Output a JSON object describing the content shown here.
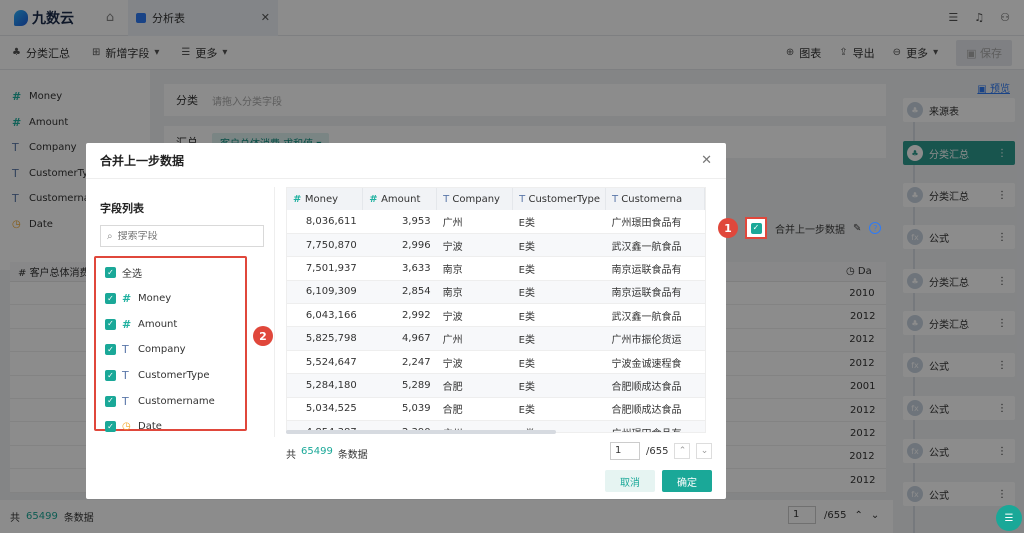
{
  "app": {
    "name": "九数云",
    "tab_title": "分析表"
  },
  "toolbar": {
    "items": [
      "分类汇总",
      "新增字段",
      "更多"
    ],
    "right": [
      "图表",
      "导出",
      "更多",
      "保存"
    ]
  },
  "fields": [
    {
      "type": "num",
      "name": "Money"
    },
    {
      "type": "num",
      "name": "Amount"
    },
    {
      "type": "text",
      "name": "Company"
    },
    {
      "type": "text",
      "name": "CustomerTy"
    },
    {
      "type": "text",
      "name": "Customerna"
    },
    {
      "type": "date",
      "name": "Date"
    }
  ],
  "config": {
    "group_label": "分类",
    "group_placeholder": "请拖入分类字段",
    "summary_label": "汇总",
    "summary_pill": "客户总体消费",
    "summary_pill_sub": "求和值"
  },
  "bg_table": {
    "head_left": "客户总体消费",
    "head_right": "Da",
    "rows": [
      {
        "a": "",
        "b": "2010"
      },
      {
        "a": "司",
        "b": "2012"
      },
      {
        "a": "",
        "b": "2012"
      },
      {
        "a": "",
        "b": "2012"
      },
      {
        "a": "司",
        "b": "2001"
      },
      {
        "a": "司",
        "b": "2012"
      },
      {
        "a": "公司北京线",
        "b": "2012"
      },
      {
        "a": "",
        "b": "2012"
      },
      {
        "a": "司",
        "b": "2012"
      }
    ]
  },
  "status": {
    "prefix": "共",
    "count": "65499",
    "suffix": "条数据",
    "page": "1",
    "total": "/655"
  },
  "flow": {
    "preview": "预览",
    "nodes": [
      "来源表",
      "分类汇总",
      "分类汇总",
      "公式",
      "分类汇总",
      "分类汇总",
      "公式",
      "公式",
      "公式",
      "公式"
    ]
  },
  "modal": {
    "title": "合并上一步数据",
    "field_list_title": "字段列表",
    "search_placeholder": "搜索字段",
    "select_all": "全选",
    "field_items": [
      {
        "type": "num",
        "name": "Money"
      },
      {
        "type": "num",
        "name": "Amount"
      },
      {
        "type": "text",
        "name": "Company"
      },
      {
        "type": "text",
        "name": "CustomerType"
      },
      {
        "type": "text",
        "name": "Customername"
      },
      {
        "type": "date",
        "name": "Date"
      }
    ],
    "columns": [
      {
        "type": "num",
        "name": "Money"
      },
      {
        "type": "num",
        "name": "Amount"
      },
      {
        "type": "text",
        "name": "Company"
      },
      {
        "type": "text",
        "name": "CustomerType"
      },
      {
        "type": "text",
        "name": "Customerna"
      }
    ],
    "rows": [
      [
        "8,036,611",
        "3,953",
        "广州",
        "E类",
        "广州璟田食品有"
      ],
      [
        "7,750,870",
        "2,996",
        "宁波",
        "E类",
        "武汉鑫一航食品"
      ],
      [
        "7,501,937",
        "3,633",
        "南京",
        "E类",
        "南京运联食品有"
      ],
      [
        "6,109,309",
        "2,854",
        "南京",
        "E类",
        "南京运联食品有"
      ],
      [
        "6,043,166",
        "2,992",
        "宁波",
        "E类",
        "武汉鑫一航食品"
      ],
      [
        "5,825,798",
        "4,967",
        "广州",
        "E类",
        "广州市振伦货运"
      ],
      [
        "5,524,647",
        "2,247",
        "宁波",
        "E类",
        "宁波金诚速程食"
      ],
      [
        "5,284,180",
        "5,289",
        "合肥",
        "E类",
        "合肥顺成达食品"
      ],
      [
        "5,034,525",
        "5,039",
        "合肥",
        "E类",
        "合肥顺成达食品"
      ],
      [
        "4,854,387",
        "2,390",
        "广州",
        "E类",
        "广州璟田食品有"
      ]
    ],
    "count_prefix": "共",
    "count": "65499",
    "count_suffix": "条数据",
    "page": "1",
    "total_pages": "/655",
    "cancel": "取消",
    "ok": "确定"
  },
  "annotations": {
    "badge1": "1",
    "badge2": "2",
    "merge_label": "合并上一步数据"
  },
  "colors": {
    "accent": "#1aa898",
    "highlight": "#e0473b",
    "link": "#2f7bf5"
  }
}
